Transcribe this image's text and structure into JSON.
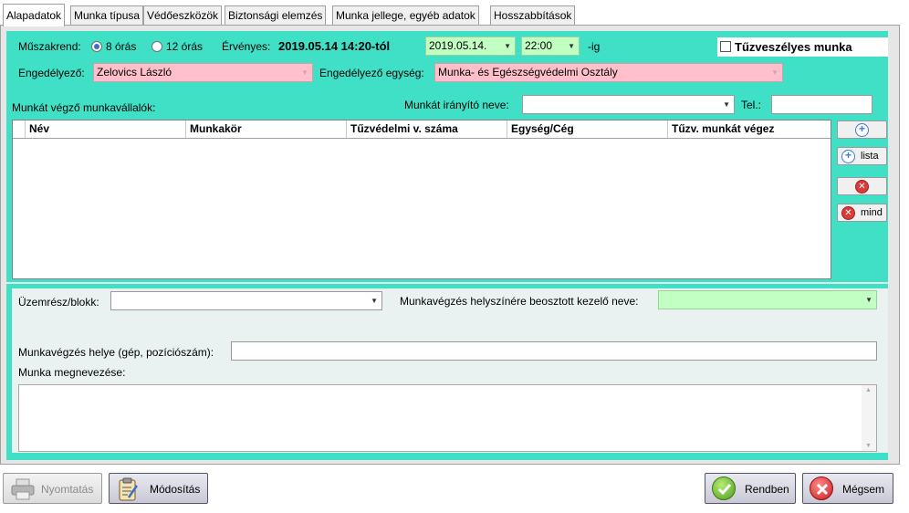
{
  "tabs": [
    "Alapadatok",
    "Munka típusa",
    "Védőeszközök",
    "Biztonsági elemzés",
    "Munka jellege, egyéb adatok",
    "Hosszabbítások"
  ],
  "shift": {
    "label": "Műszakrend:",
    "option1": "8 órás",
    "option2": "12 órás",
    "selected": "8 órás"
  },
  "validity": {
    "label": "Érvényes:",
    "from": "2019.05.14 14:20-tól",
    "to_date": "2019.05.14.",
    "to_time": "22:00",
    "suffix": "-ig"
  },
  "fire_work": {
    "label": "Tűzveszélyes munka",
    "checked": false
  },
  "approver": {
    "label": "Engedélyező:",
    "value": "Zelovics László"
  },
  "approver_unit": {
    "label": "Engedélyező egység:",
    "value": "Munka- és Egészségvédelmi Osztály"
  },
  "workers_label": "Munkát végző munkavállalók:",
  "supervisor": {
    "label": "Munkát irányító neve:",
    "value": ""
  },
  "phone": {
    "label": "Tel.:",
    "value": ""
  },
  "grid": {
    "columns": [
      "Név",
      "Munkakör",
      "Tűzvédelmi v. száma",
      "Egység/Cég",
      "Tűzv. munkát végez"
    ],
    "rows": []
  },
  "side_buttons": {
    "list": "lista",
    "all": "mind"
  },
  "plant_unit": {
    "label": "Üzemrész/blokk:",
    "value": ""
  },
  "site_operator": {
    "label": "Munkavégzés helyszínére beosztott kezelő neve:",
    "value": ""
  },
  "work_location": {
    "label": "Munkavégzés helye (gép, pozíciószám):",
    "value": ""
  },
  "work_name": {
    "label": "Munka megnevezése:",
    "value": ""
  },
  "buttons": {
    "print": "Nyomtatás",
    "modify": "Módosítás",
    "ok": "Rendben",
    "cancel": "Mégsem"
  }
}
